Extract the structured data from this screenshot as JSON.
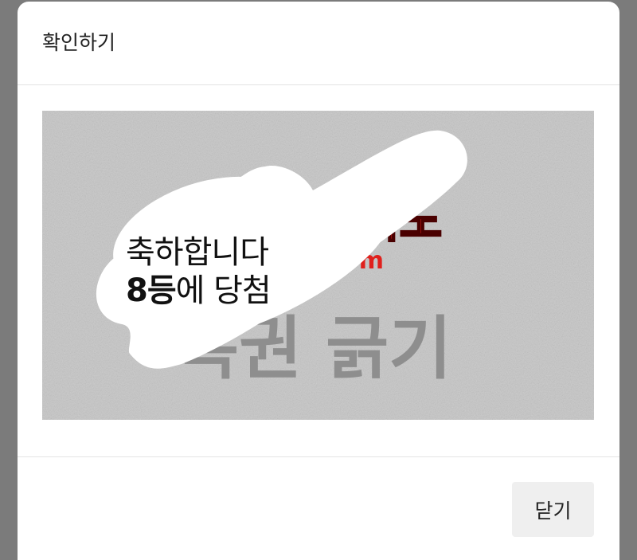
{
  "modal": {
    "title": "확인하기"
  },
  "scratch_card": {
    "brand_text": "카지노",
    "domain_text": ".com",
    "scratch_label": "복권 긁기",
    "result_line1": "축하합니다",
    "result_rank": "8등",
    "result_line2_rest": "에 당첨"
  },
  "footer": {
    "close_label": "닫기"
  }
}
